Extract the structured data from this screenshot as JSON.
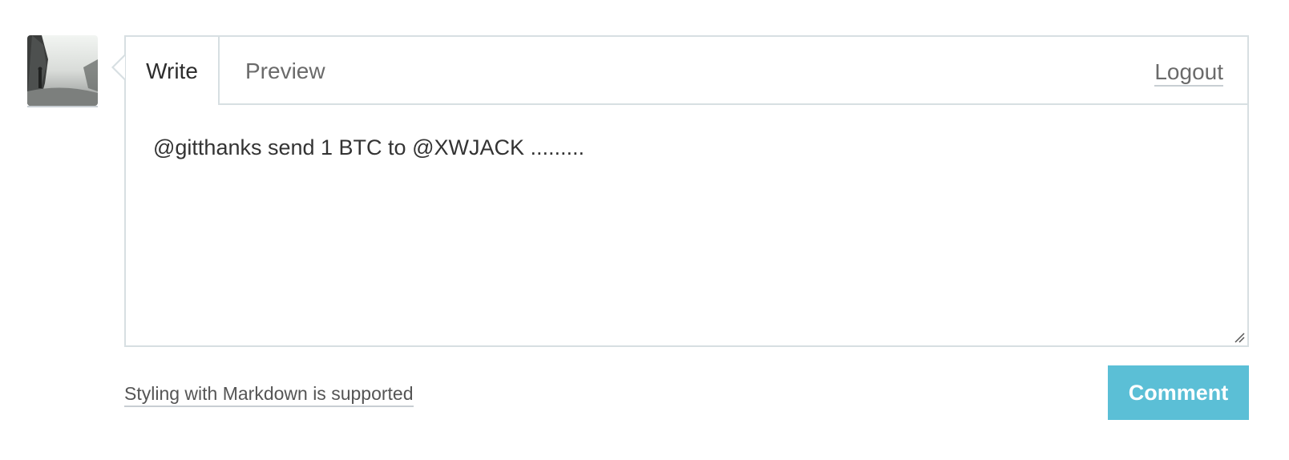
{
  "user": {
    "avatar_icon": "user-avatar-photo"
  },
  "editor": {
    "tabs": [
      {
        "label": "Write",
        "active": true
      },
      {
        "label": "Preview",
        "active": false
      }
    ],
    "logout_label": "Logout",
    "textarea_value": "@gitthanks send 1 BTC to @XWJACK .........",
    "resize_icon": "resize-grip-icon"
  },
  "footer": {
    "markdown_label": "Styling with Markdown is supported",
    "comment_label": "Comment"
  },
  "colors": {
    "accent": "#5bbfd6",
    "border": "#d7dfe2",
    "text": "#333333",
    "muted_text": "#6a6a6a"
  }
}
